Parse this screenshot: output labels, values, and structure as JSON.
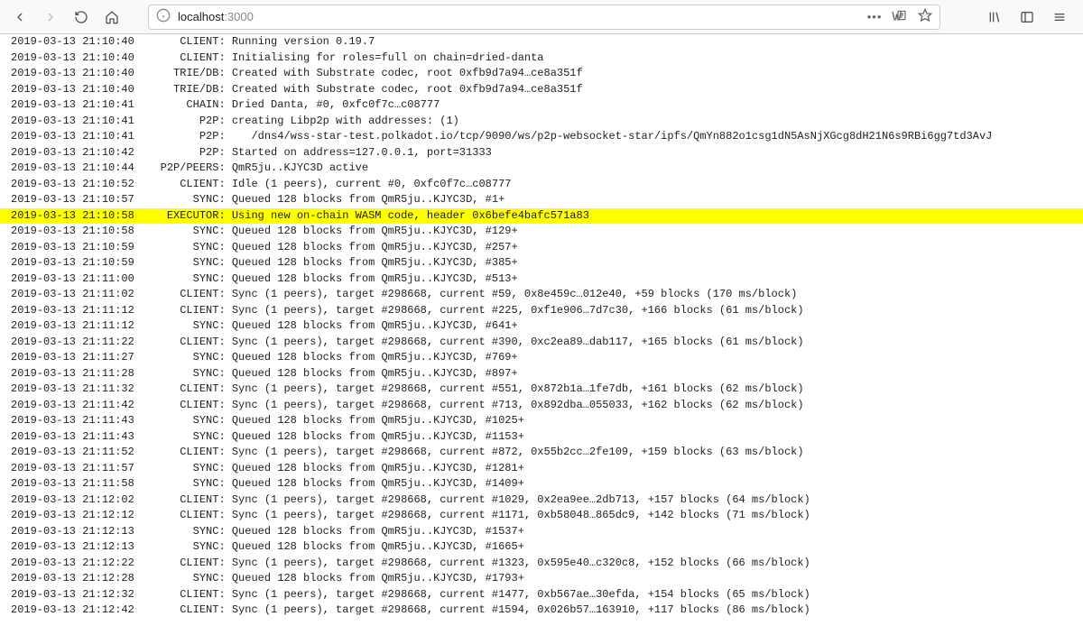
{
  "browser": {
    "url_host": "localhost",
    "url_port": ":3000"
  },
  "log": {
    "highlight_index": 11,
    "lines": [
      {
        "ts": "2019-03-13 21:10:40",
        "tag": "CLIENT",
        "msg": "Running version 0.19.7"
      },
      {
        "ts": "2019-03-13 21:10:40",
        "tag": "CLIENT",
        "msg": "Initialising for roles=full on chain=dried-danta"
      },
      {
        "ts": "2019-03-13 21:10:40",
        "tag": "TRIE/DB",
        "msg": "Created with Substrate codec, root 0xfb9d7a94…ce8a351f"
      },
      {
        "ts": "2019-03-13 21:10:40",
        "tag": "TRIE/DB",
        "msg": "Created with Substrate codec, root 0xfb9d7a94…ce8a351f"
      },
      {
        "ts": "2019-03-13 21:10:41",
        "tag": "CHAIN",
        "msg": "Dried Danta, #0, 0xfc0f7c…c08777"
      },
      {
        "ts": "2019-03-13 21:10:41",
        "tag": "P2P",
        "msg": "creating Libp2p with addresses: (1)"
      },
      {
        "ts": "2019-03-13 21:10:41",
        "tag": "P2P",
        "msg": "   /dns4/wss-star-test.polkadot.io/tcp/9090/ws/p2p-websocket-star/ipfs/QmYn882o1csg1dN5AsNjXGcg8dH21N6s9RBi6gg7td3AvJ"
      },
      {
        "ts": "2019-03-13 21:10:42",
        "tag": "P2P",
        "msg": "Started on address=127.0.0.1, port=31333"
      },
      {
        "ts": "2019-03-13 21:10:44",
        "tag": "P2P/PEERS",
        "msg": "QmR5ju..KJYC3D active"
      },
      {
        "ts": "2019-03-13 21:10:52",
        "tag": "CLIENT",
        "msg": "Idle (1 peers), current #0, 0xfc0f7c…c08777"
      },
      {
        "ts": "2019-03-13 21:10:57",
        "tag": "SYNC",
        "msg": "Queued 128 blocks from QmR5ju..KJYC3D, #1+"
      },
      {
        "ts": "2019-03-13 21:10:58",
        "tag": "EXECUTOR",
        "msg": "Using new on-chain WASM code, header 0x6befe4bafc571a83"
      },
      {
        "ts": "2019-03-13 21:10:58",
        "tag": "SYNC",
        "msg": "Queued 128 blocks from QmR5ju..KJYC3D, #129+"
      },
      {
        "ts": "2019-03-13 21:10:59",
        "tag": "SYNC",
        "msg": "Queued 128 blocks from QmR5ju..KJYC3D, #257+"
      },
      {
        "ts": "2019-03-13 21:10:59",
        "tag": "SYNC",
        "msg": "Queued 128 blocks from QmR5ju..KJYC3D, #385+"
      },
      {
        "ts": "2019-03-13 21:11:00",
        "tag": "SYNC",
        "msg": "Queued 128 blocks from QmR5ju..KJYC3D, #513+"
      },
      {
        "ts": "2019-03-13 21:11:02",
        "tag": "CLIENT",
        "msg": "Sync (1 peers), target #298668, current #59, 0x8e459c…012e40, +59 blocks (170 ms/block)"
      },
      {
        "ts": "2019-03-13 21:11:12",
        "tag": "CLIENT",
        "msg": "Sync (1 peers), target #298668, current #225, 0xf1e906…7d7c30, +166 blocks (61 ms/block)"
      },
      {
        "ts": "2019-03-13 21:11:12",
        "tag": "SYNC",
        "msg": "Queued 128 blocks from QmR5ju..KJYC3D, #641+"
      },
      {
        "ts": "2019-03-13 21:11:22",
        "tag": "CLIENT",
        "msg": "Sync (1 peers), target #298668, current #390, 0xc2ea89…dab117, +165 blocks (61 ms/block)"
      },
      {
        "ts": "2019-03-13 21:11:27",
        "tag": "SYNC",
        "msg": "Queued 128 blocks from QmR5ju..KJYC3D, #769+"
      },
      {
        "ts": "2019-03-13 21:11:28",
        "tag": "SYNC",
        "msg": "Queued 128 blocks from QmR5ju..KJYC3D, #897+"
      },
      {
        "ts": "2019-03-13 21:11:32",
        "tag": "CLIENT",
        "msg": "Sync (1 peers), target #298668, current #551, 0x872b1a…1fe7db, +161 blocks (62 ms/block)"
      },
      {
        "ts": "2019-03-13 21:11:42",
        "tag": "CLIENT",
        "msg": "Sync (1 peers), target #298668, current #713, 0x892dba…055033, +162 blocks (62 ms/block)"
      },
      {
        "ts": "2019-03-13 21:11:43",
        "tag": "SYNC",
        "msg": "Queued 128 blocks from QmR5ju..KJYC3D, #1025+"
      },
      {
        "ts": "2019-03-13 21:11:43",
        "tag": "SYNC",
        "msg": "Queued 128 blocks from QmR5ju..KJYC3D, #1153+"
      },
      {
        "ts": "2019-03-13 21:11:52",
        "tag": "CLIENT",
        "msg": "Sync (1 peers), target #298668, current #872, 0x55b2cc…2fe109, +159 blocks (63 ms/block)"
      },
      {
        "ts": "2019-03-13 21:11:57",
        "tag": "SYNC",
        "msg": "Queued 128 blocks from QmR5ju..KJYC3D, #1281+"
      },
      {
        "ts": "2019-03-13 21:11:58",
        "tag": "SYNC",
        "msg": "Queued 128 blocks from QmR5ju..KJYC3D, #1409+"
      },
      {
        "ts": "2019-03-13 21:12:02",
        "tag": "CLIENT",
        "msg": "Sync (1 peers), target #298668, current #1029, 0x2ea9ee…2db713, +157 blocks (64 ms/block)"
      },
      {
        "ts": "2019-03-13 21:12:12",
        "tag": "CLIENT",
        "msg": "Sync (1 peers), target #298668, current #1171, 0xb58048…865dc9, +142 blocks (71 ms/block)"
      },
      {
        "ts": "2019-03-13 21:12:13",
        "tag": "SYNC",
        "msg": "Queued 128 blocks from QmR5ju..KJYC3D, #1537+"
      },
      {
        "ts": "2019-03-13 21:12:13",
        "tag": "SYNC",
        "msg": "Queued 128 blocks from QmR5ju..KJYC3D, #1665+"
      },
      {
        "ts": "2019-03-13 21:12:22",
        "tag": "CLIENT",
        "msg": "Sync (1 peers), target #298668, current #1323, 0x595e40…c320c8, +152 blocks (66 ms/block)"
      },
      {
        "ts": "2019-03-13 21:12:28",
        "tag": "SYNC",
        "msg": "Queued 128 blocks from QmR5ju..KJYC3D, #1793+"
      },
      {
        "ts": "2019-03-13 21:12:32",
        "tag": "CLIENT",
        "msg": "Sync (1 peers), target #298668, current #1477, 0xb567ae…30efda, +154 blocks (65 ms/block)"
      },
      {
        "ts": "2019-03-13 21:12:42",
        "tag": "CLIENT",
        "msg": "Sync (1 peers), target #298668, current #1594, 0x026b57…163910, +117 blocks (86 ms/block)"
      }
    ]
  }
}
